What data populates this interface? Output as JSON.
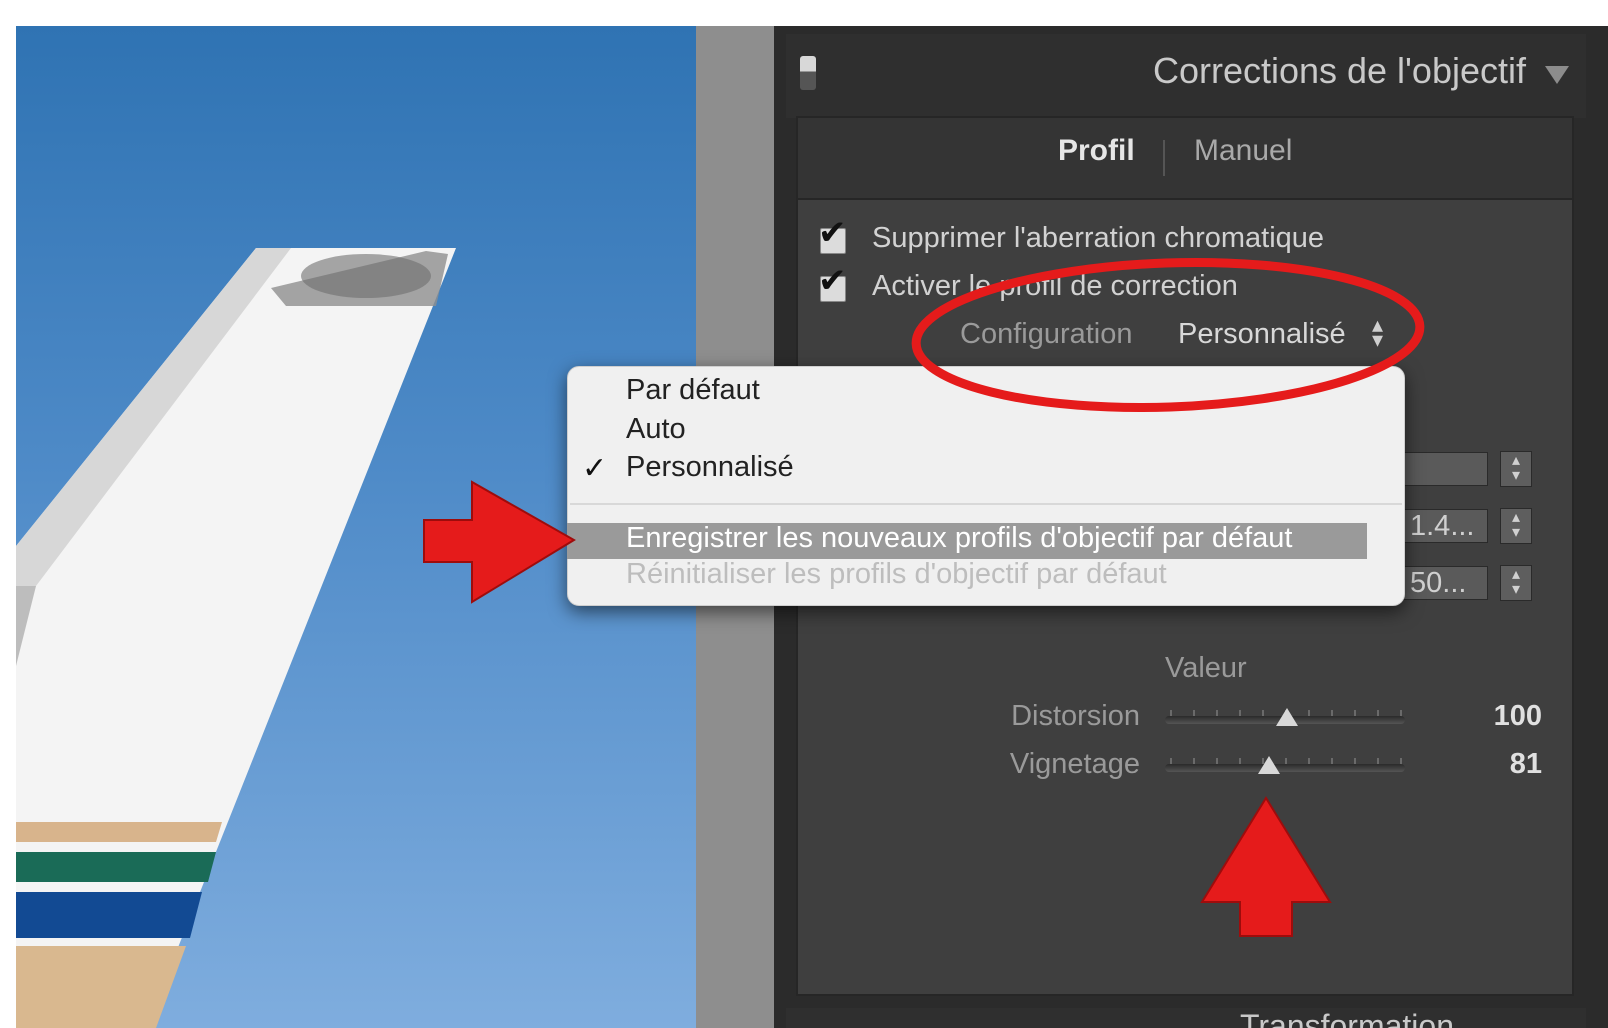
{
  "panel": {
    "title": "Corrections de l'objectif",
    "tabs": [
      {
        "label": "Profil",
        "active": true
      },
      {
        "label": "Manuel",
        "active": false
      }
    ],
    "checkboxes": [
      {
        "label": "Supprimer l'aberration chromatique",
        "checked": true
      },
      {
        "label": "Activer le profil de correction",
        "checked": true
      }
    ],
    "configuration": {
      "label": "Configuration",
      "value": "Personnalisé"
    },
    "lens_fields": [
      "1.4...",
      "50..."
    ],
    "amount": {
      "title": "Valeur",
      "sliders": [
        {
          "label": "Distorsion",
          "value": "100"
        },
        {
          "label": "Vignetage",
          "value": "81"
        }
      ]
    },
    "next_panel_title": "Transformation"
  },
  "menu": {
    "items": [
      {
        "label": "Par défaut",
        "checked": false
      },
      {
        "label": "Auto",
        "checked": false
      },
      {
        "label": "Personnalisé",
        "checked": true
      }
    ],
    "actions": [
      {
        "label": "Enregistrer les nouveaux profils d'objectif par défaut",
        "highlighted": true,
        "enabled": true
      },
      {
        "label": "Réinitialiser les profils d'objectif par défaut",
        "highlighted": false,
        "enabled": false
      }
    ]
  },
  "icons": {
    "checkmark": "checkmark-icon",
    "collapse": "triangle-down-icon",
    "stepper": "stepper-arrows-icon"
  },
  "colors": {
    "panel_bg": "#3f3f3f",
    "annotation_red": "#e51b1b",
    "sky": "#4f8bc8"
  }
}
